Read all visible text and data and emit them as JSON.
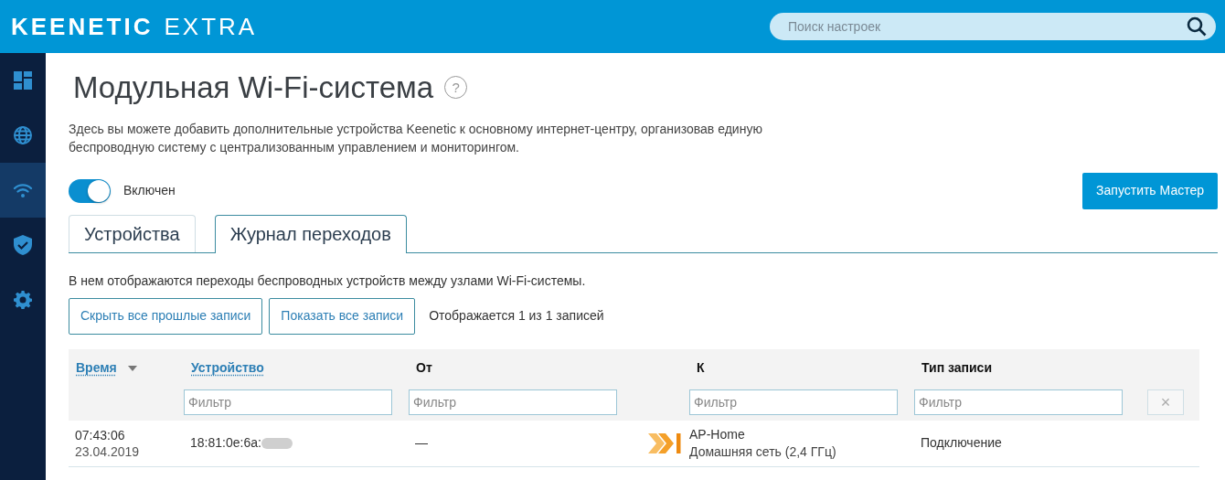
{
  "header": {
    "brand": "KEENETIC",
    "model": "EXTRA",
    "search": {
      "placeholder": "Поиск настроек"
    }
  },
  "sidebar": {
    "items": [
      {
        "kind": "dashboard",
        "selected": false
      },
      {
        "kind": "globe",
        "selected": false
      },
      {
        "kind": "wifi",
        "selected": true
      },
      {
        "kind": "shield",
        "selected": false
      },
      {
        "kind": "gear",
        "selected": false
      }
    ]
  },
  "page": {
    "title": "Модульная Wi-Fi-система",
    "help": "?",
    "description": "Здесь вы можете добавить дополнительные устройства Keenetic к основному интернет-центру, организовав единую беспроводную систему с централизованным управлением и мониторингом.",
    "toggle": {
      "label": "Включен",
      "on": true
    },
    "wizard_button": "Запустить Мастер"
  },
  "tabs": [
    {
      "label": "Устройства",
      "selected": false
    },
    {
      "label": "Журнал переходов",
      "selected": true
    }
  ],
  "log": {
    "note": "В нем отображаются переходы беспроводных устройств между узлами Wi-Fi-системы.",
    "buttons": [
      "Скрыть все прошлые записи",
      "Показать все записи"
    ],
    "count": "Отображается 1 из 1 записей",
    "table": {
      "columns": [
        {
          "label": "Время",
          "sortable": true,
          "sorted": true
        },
        {
          "label": "Устройство",
          "sortable": true,
          "sorted": false,
          "filter_placeholder": "Фильтр"
        },
        {
          "label": "От",
          "sortable": false,
          "sorted": false,
          "filter_placeholder": "Фильтр"
        },
        {
          "label": "К",
          "sortable": false,
          "sorted": false,
          "filter_placeholder": "Фильтр"
        },
        {
          "label": "Тип записи",
          "sortable": false,
          "sorted": false,
          "filter_placeholder": "Фильтр"
        }
      ],
      "clear": "×",
      "rows": [
        {
          "time": "07:43:06",
          "date": "23.04.2019",
          "device": "18:81:0e:6a:",
          "device_redacted": true,
          "from": "—",
          "to_name": "AP-Home",
          "to_network": "Домашняя сеть (2,4 ГГц)",
          "type": "Подключение"
        }
      ]
    }
  }
}
